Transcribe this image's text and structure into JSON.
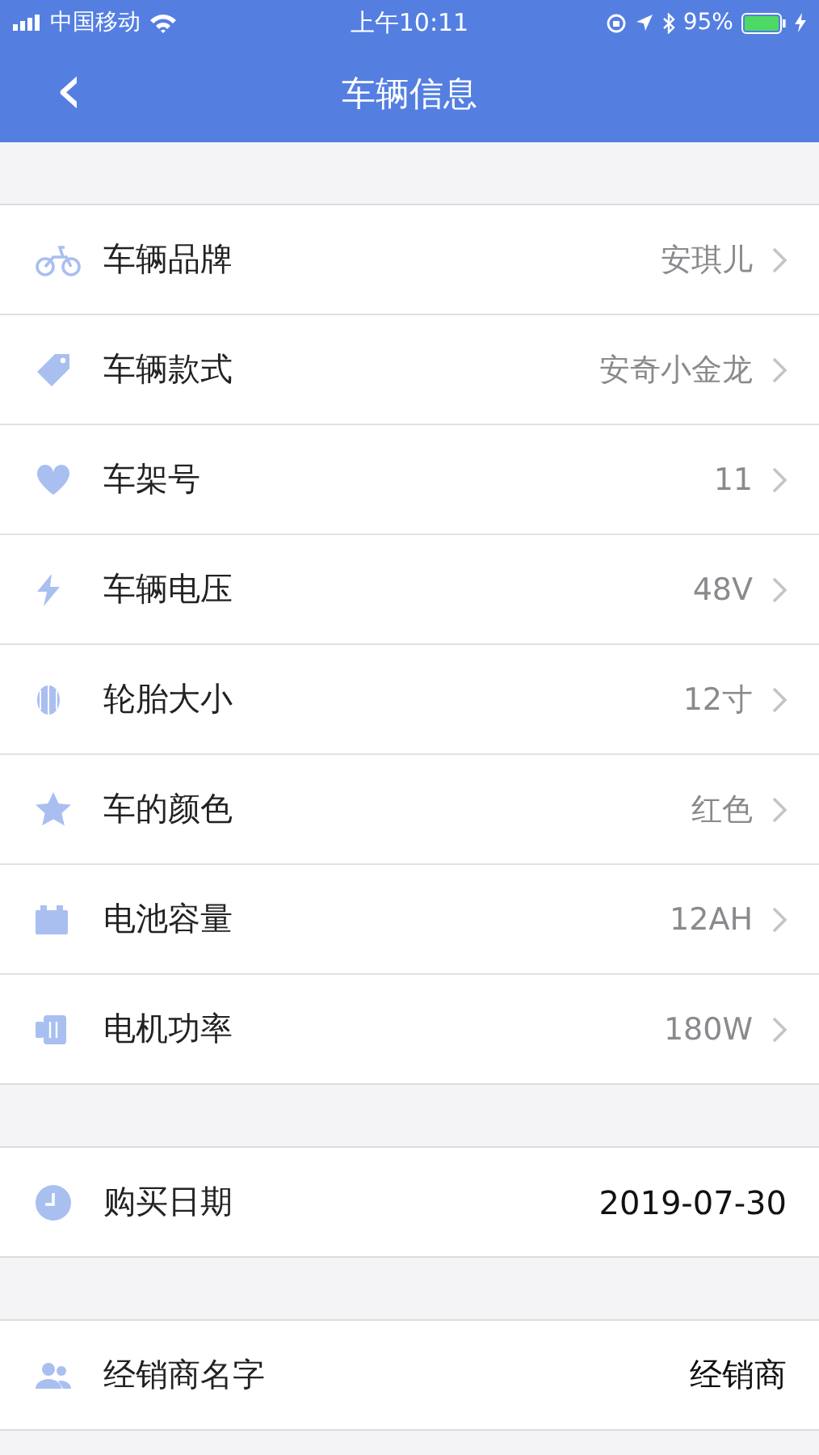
{
  "status_bar": {
    "carrier": "中国移动",
    "time": "上午10:11",
    "battery": "95%"
  },
  "nav": {
    "back": "‹",
    "title": "车辆信息"
  },
  "sections": [
    {
      "rows": [
        {
          "label": "车辆品牌",
          "value": "安琪儿",
          "kind": "chevron"
        },
        {
          "label": "车辆款式",
          "value": "安奇小金龙",
          "kind": "chevron"
        },
        {
          "label": "车架号",
          "value": "11",
          "kind": "chevron"
        },
        {
          "label": "车辆电压",
          "value": "48V",
          "kind": "chevron"
        },
        {
          "label": "轮胎大小",
          "value": "12寸",
          "kind": "chevron"
        },
        {
          "label": "车的颜色",
          "value": "红色",
          "kind": "chevron"
        },
        {
          "label": "电池容量",
          "value": "12AH",
          "kind": "chevron"
        },
        {
          "label": "电机功率",
          "value": "180W",
          "kind": "chevron"
        }
      ]
    },
    {
      "rows": [
        {
          "label": "购买日期",
          "value": "2019-07-30",
          "kind": "plain"
        }
      ]
    },
    {
      "rows": [
        {
          "label": "经销商名字",
          "value": "经销商",
          "kind": "plain"
        }
      ]
    }
  ]
}
